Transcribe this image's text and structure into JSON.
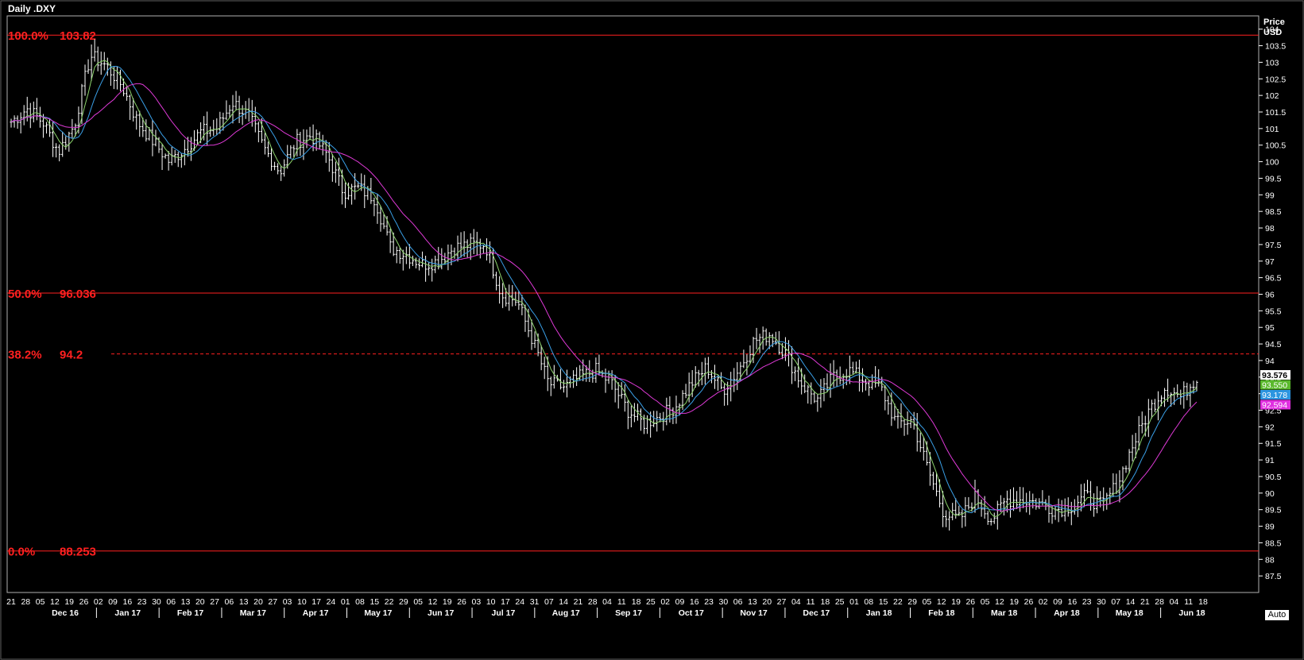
{
  "window": {
    "title": "Daily .DXY"
  },
  "axis": {
    "price_label": "Price",
    "currency_label": "USD",
    "auto_label": "Auto"
  },
  "colors": {
    "background": "#000000",
    "bars": "#ffffff",
    "fib": "#ff2020",
    "ma_fast": "#8cd36c",
    "ma_mid": "#3aa0e8",
    "ma_slow": "#e03ad8"
  },
  "chart_data": {
    "type": "ohlc-bar",
    "ylim": [
      87,
      104.4
    ],
    "yticks": [
      87.5,
      88,
      88.5,
      89,
      89.5,
      90,
      90.5,
      91,
      91.5,
      92,
      92.5,
      93,
      93.5,
      94,
      94.5,
      95,
      95.5,
      96,
      96.5,
      97,
      97.5,
      98,
      98.5,
      99,
      99.5,
      100,
      100.5,
      101,
      101.5,
      102,
      102.5,
      103,
      103.5,
      104
    ],
    "x_day_labels": [
      "21",
      "28",
      "05",
      "12",
      "19",
      "26",
      "02",
      "09",
      "16",
      "23",
      "30",
      "06",
      "13",
      "20",
      "27",
      "06",
      "13",
      "20",
      "27",
      "03",
      "10",
      "17",
      "24",
      "01",
      "08",
      "15",
      "22",
      "29",
      "05",
      "12",
      "19",
      "26",
      "03",
      "10",
      "17",
      "24",
      "31",
      "07",
      "14",
      "21",
      "28",
      "04",
      "11",
      "18",
      "25",
      "02",
      "09",
      "16",
      "23",
      "30",
      "06",
      "13",
      "20",
      "27",
      "04",
      "11",
      "18",
      "25",
      "01",
      "08",
      "15",
      "22",
      "29",
      "05",
      "12",
      "19",
      "26",
      "05",
      "12",
      "19",
      "26",
      "02",
      "09",
      "16",
      "23",
      "30",
      "07",
      "14",
      "21",
      "28",
      "04",
      "11",
      "18"
    ],
    "x_month_labels": [
      "Dec 16",
      "Jan 17",
      "Feb 17",
      "Mar 17",
      "Apr 17",
      "May 17",
      "Jun 17",
      "Jul 17",
      "Aug 17",
      "Sep 17",
      "Oct 17",
      "Nov 17",
      "Dec 17",
      "Jan 18",
      "Feb 18",
      "Mar 18",
      "Apr 18",
      "May 18",
      "Jun 18"
    ],
    "fibonacci": [
      {
        "label": "100.0%",
        "value": "103.82",
        "level": 103.82,
        "style": "solid"
      },
      {
        "label": "50.0%",
        "value": "96.036",
        "level": 96.036,
        "style": "solid"
      },
      {
        "label": "38.2%",
        "value": "94.2",
        "level": 94.2,
        "style": "dashed"
      },
      {
        "label": "0.0%",
        "value": "88.253",
        "level": 88.253,
        "style": "solid"
      }
    ],
    "weekly_closes": [
      101.2,
      101.6,
      101.2,
      100.3,
      101.1,
      103.2,
      102.9,
      102.3,
      101.2,
      100.6,
      100.0,
      100.4,
      100.9,
      101.0,
      101.8,
      101.4,
      100.4,
      99.7,
      100.6,
      100.8,
      100.2,
      99.1,
      99.2,
      98.9,
      97.4,
      97.2,
      96.9,
      97.0,
      97.4,
      97.5,
      97.5,
      96.0,
      95.8,
      94.6,
      93.3,
      93.2,
      93.5,
      93.7,
      93.3,
      92.5,
      92.1,
      92.3,
      92.6,
      93.3,
      93.8,
      93.1,
      93.7,
      94.6,
      94.8,
      94.2,
      93.3,
      92.8,
      93.5,
      93.7,
      93.4,
      93.2,
      92.1,
      92.2,
      90.7,
      89.4,
      89.2,
      89.9,
      89.2,
      89.8,
      89.8,
      89.7,
      89.5,
      89.6,
      89.9,
      89.6,
      90.3,
      91.5,
      92.5,
      93.2,
      92.9,
      93.5
    ],
    "last_price": 93.576,
    "price_tags": [
      {
        "value": "93.576",
        "bg": "#ffffff",
        "fg": "#000000"
      },
      {
        "value": "93.550",
        "bg": "#5ab92c",
        "fg": "#ffffff"
      },
      {
        "value": "93.178",
        "bg": "#2c95e0",
        "fg": "#ffffff"
      },
      {
        "value": "92.594",
        "bg": "#e030e0",
        "fg": "#ffffff"
      }
    ]
  }
}
